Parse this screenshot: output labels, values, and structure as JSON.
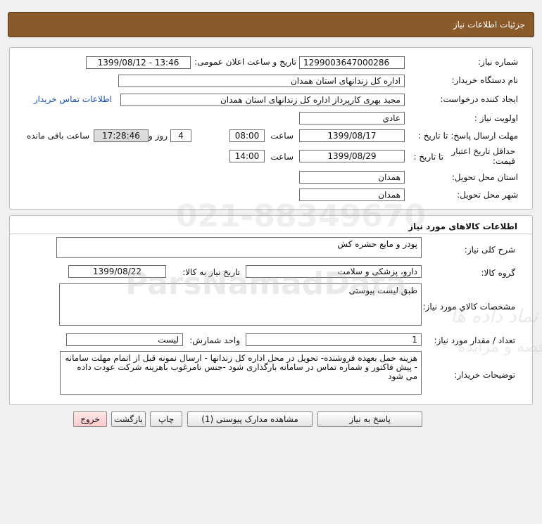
{
  "page_title": "جزئیات اطلاعات نیاز",
  "info": {
    "need_number_label": "شماره نیاز:",
    "need_number": "1299003647000286",
    "announce_label": "تاریخ و ساعت اعلان عمومی:",
    "announce_value": "1399/08/12 - 13:46",
    "buyer_org_label": "نام دستگاه خریدار:",
    "buyer_org": "اداره کل زندانهای استان همدان",
    "creator_label": "ایجاد کننده درخواست:",
    "creator": "مجید بهری کارپرداز اداره کل زندانهای استان همدان",
    "contact_link": "اطلاعات تماس خریدار",
    "priority_label": "اولویت نیاز :",
    "priority": "عادي",
    "deadline_label": "مهلت ارسال پاسخ: تا تاریخ :",
    "deadline_date": "1399/08/17",
    "time_label": "ساعت",
    "deadline_time": "08:00",
    "days_value": "4",
    "days_label": "روز و",
    "remaining_time": "17:28:46",
    "remaining_label": "ساعت باقی مانده",
    "validity_label": "حداقل تاریخ اعتبار قیمت:",
    "validity_date_label": "تا تاریخ :",
    "validity_date": "1399/08/29",
    "validity_time": "14:00",
    "province_label": "استان محل تحویل:",
    "province": "همدان",
    "city_label": "شهر محل تحویل:",
    "city": "همدان"
  },
  "goods": {
    "section_title": "اطلاعات کالاهای مورد نیاز",
    "summary_label": "شرح کلی نیاز:",
    "summary": "پودر و مایع حشره کش",
    "group_label": "گروه کالا:",
    "group": "دارو، پزشکی و سلامت",
    "need_date_label": "تاریخ نیاز به کالا:",
    "need_date": "1399/08/22",
    "specs_label": "مشخصات کالاي مورد نیاز:",
    "specs": "طبق لیست پیوستی",
    "qty_label": "تعداد / مقدار مورد نیاز:",
    "qty": "1",
    "unit_label": "واحد شمارش:",
    "unit": "لیست",
    "notes_label": "توضیحات خریدار:",
    "notes": "هزینه حمل بعهده فروشنده- تحویل در محل اداره کل زندانها - ارسال نمونه قبل از اتمام مهلت سامانه - پیش فاکتور و شماره تماس در سامانه بارگذاری شود -جنس نامرغوب باهزینه شرکت عودت داده می شود"
  },
  "buttons": {
    "reply": "پاسخ به نیاز",
    "attachments": "مشاهده مدارک پیوستی (1)",
    "print": "چاپ",
    "back": "بازگشت",
    "exit": "خروج"
  },
  "watermark": {
    "latin": "ParsNamadData",
    "persian_1": "مرکز فرآوری اطلاعات پارس نماد داده ها",
    "persian_2": "پایگاه اطلاع رسانی مناقصه و مزایده",
    "phone": "021-88349670"
  },
  "colors": {
    "title_bar": "#8b5a2b",
    "remaining_box": "#dcdcdc",
    "link": "#1a4fb5",
    "exit_button": "#ffd6d6"
  }
}
